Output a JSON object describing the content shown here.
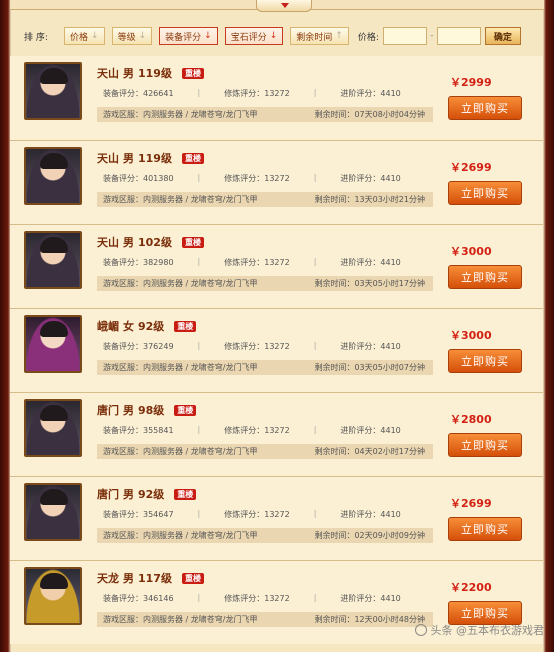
{
  "sortbar": {
    "label": "排 序:",
    "buttons": [
      {
        "label": "价格",
        "arrow": "↓",
        "active": false
      },
      {
        "label": "等级",
        "arrow": "↓",
        "active": false
      },
      {
        "label": "装备评分",
        "arrow": "↓",
        "active": true
      },
      {
        "label": "宝石评分",
        "arrow": "↓",
        "active": true
      },
      {
        "label": "剩余时间",
        "arrow": "↑",
        "active": false
      }
    ],
    "price_label": "价格:",
    "price_min": "",
    "price_max": "",
    "dash": "-",
    "confirm": "确定"
  },
  "listings": [
    {
      "school": "天山",
      "gender": "男",
      "level": "119级",
      "badge": "重楼",
      "equip": "装备评分：426641",
      "refine": "修炼评分：13272",
      "advance": "进阶评分：4410",
      "server": "游戏区服：内测服务器 / 龙啸苍穹/龙门飞甲",
      "remain": "剩余时间：07天08小时04分钟",
      "price": "￥2999",
      "buy": "立即购买",
      "avatar": "avatar-portrait"
    },
    {
      "school": "天山",
      "gender": "男",
      "level": "119级",
      "badge": "重楼",
      "equip": "装备评分：401380",
      "refine": "修炼评分：13272",
      "advance": "进阶评分：4410",
      "server": "游戏区服：内测服务器 / 龙啸苍穹/龙门飞甲",
      "remain": "剩余时间：13天03小时21分钟",
      "price": "￥2699",
      "buy": "立即购买",
      "avatar": "avatar-portrait"
    },
    {
      "school": "天山",
      "gender": "男",
      "level": "102级",
      "badge": "重楼",
      "equip": "装备评分：382980",
      "refine": "修炼评分：13272",
      "advance": "进阶评分：4410",
      "server": "游戏区服：内测服务器 / 龙啸苍穹/龙门飞甲",
      "remain": "剩余时间：03天05小时17分钟",
      "price": "￥3000",
      "buy": "立即购买",
      "avatar": "avatar-portrait"
    },
    {
      "school": "峨嵋",
      "gender": "女",
      "level": "92级",
      "badge": "重楼",
      "equip": "装备评分：376249",
      "refine": "修炼评分：13272",
      "advance": "进阶评分：4410",
      "server": "游戏区服：内测服务器 / 龙啸苍穹/龙门飞甲",
      "remain": "剩余时间：03天05小时07分钟",
      "price": "￥3000",
      "buy": "立即购买",
      "avatar": "avatar-portrait"
    },
    {
      "school": "唐门",
      "gender": "男",
      "level": "98级",
      "badge": "重楼",
      "equip": "装备评分：355841",
      "refine": "修炼评分：13272",
      "advance": "进阶评分：4410",
      "server": "游戏区服：内测服务器 / 龙啸苍穹/龙门飞甲",
      "remain": "剩余时间：04天02小时17分钟",
      "price": "￥2800",
      "buy": "立即购买",
      "avatar": "avatar-portrait"
    },
    {
      "school": "唐门",
      "gender": "男",
      "level": "92级",
      "badge": "重楼",
      "equip": "装备评分：354647",
      "refine": "修炼评分：13272",
      "advance": "进阶评分：4410",
      "server": "游戏区服：内测服务器 / 龙啸苍穹/龙门飞甲",
      "remain": "剩余时间：02天09小时09分钟",
      "price": "￥2699",
      "buy": "立即购买",
      "avatar": "avatar-portrait"
    },
    {
      "school": "天龙",
      "gender": "男",
      "level": "117级",
      "badge": "重楼",
      "equip": "装备评分：346146",
      "refine": "修炼评分：13272",
      "advance": "进阶评分：4410",
      "server": "游戏区服：内测服务器 / 龙啸苍穹/龙门飞甲",
      "remain": "剩余时间：12天00小时48分钟",
      "price": "￥2200",
      "buy": "立即购买",
      "avatar": "avatar-portrait"
    }
  ],
  "watermark": "头条 @五本布衣游戏君"
}
